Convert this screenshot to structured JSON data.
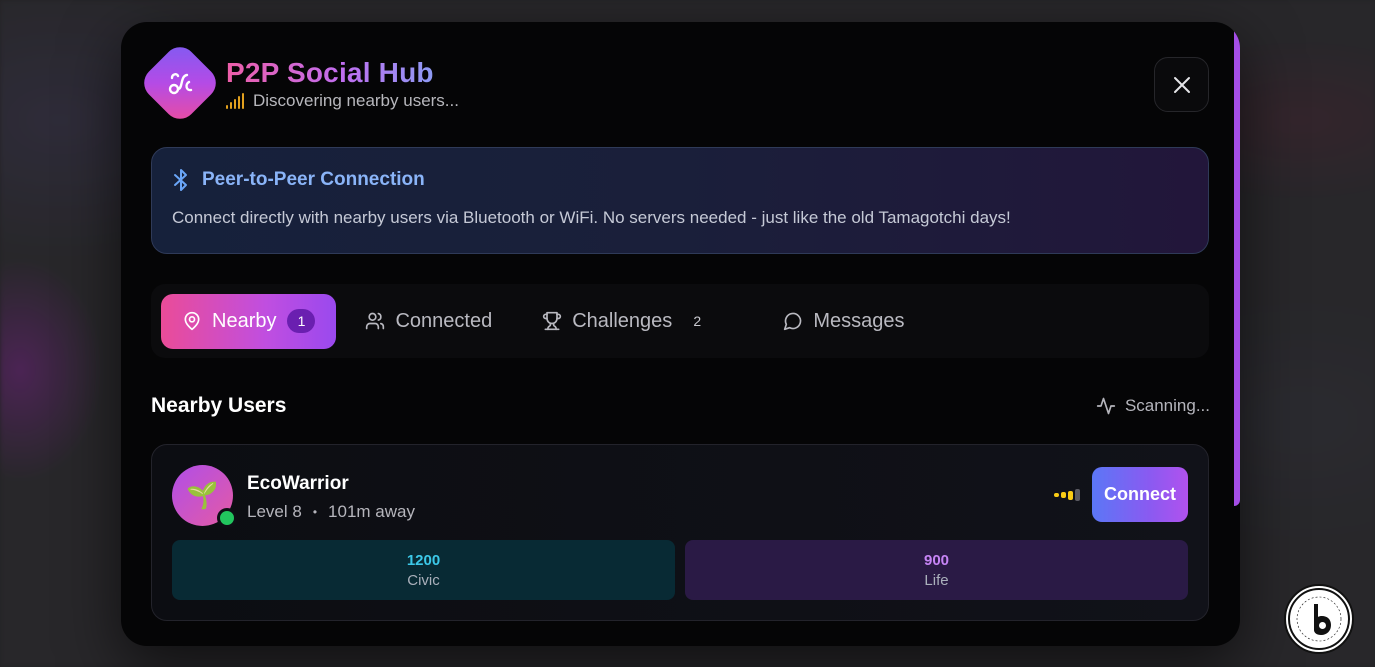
{
  "header": {
    "title": "P2P Social Hub",
    "status": "Discovering nearby users..."
  },
  "info": {
    "title": "Peer-to-Peer Connection",
    "text": "Connect directly with nearby users via Bluetooth or WiFi. No servers needed - just like the old Tamagotchi days!"
  },
  "tabs": [
    {
      "label": "Nearby",
      "badge": "1",
      "active": true,
      "icon": "map-pin-icon"
    },
    {
      "label": "Connected",
      "badge": "",
      "active": false,
      "icon": "users-icon"
    },
    {
      "label": "Challenges",
      "badge": "2",
      "active": false,
      "icon": "trophy-icon"
    },
    {
      "label": "Messages",
      "badge": "",
      "active": false,
      "icon": "message-circle-icon"
    }
  ],
  "section": {
    "title": "Nearby Users",
    "scanning": "Scanning..."
  },
  "user": {
    "name": "EcoWarrior",
    "avatar_emoji": "🌱",
    "level": "Level 8",
    "separator": "•",
    "distance": "101m away",
    "connect_label": "Connect",
    "online": true,
    "signal_strength": 3,
    "stats": [
      {
        "value": "1200",
        "label": "Civic"
      },
      {
        "value": "900",
        "label": "Life"
      }
    ]
  },
  "colors": {
    "accent_pink": "#ea4c98",
    "accent_purple": "#9a49ee",
    "info_blue": "#8ab4f8",
    "online_green": "#22c55e",
    "signal_yellow": "#facc15"
  }
}
